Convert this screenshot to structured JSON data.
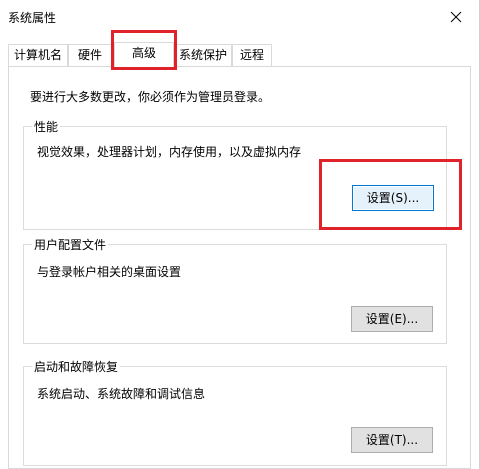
{
  "window": {
    "title": "系统属性"
  },
  "tabs": [
    {
      "label": "计算机名"
    },
    {
      "label": "硬件"
    },
    {
      "label": "高级"
    },
    {
      "label": "系统保护"
    },
    {
      "label": "远程"
    }
  ],
  "active_tab": "高级",
  "advanced": {
    "intro": "要进行大多数更改，你必须作为管理员登录。",
    "performance": {
      "title": "性能",
      "description": "视觉效果，处理器计划，内存使用，以及虚拟内存",
      "button": "设置(S)..."
    },
    "user_profiles": {
      "title": "用户配置文件",
      "description": "与登录帐户相关的桌面设置",
      "button": "设置(E)..."
    },
    "startup_recovery": {
      "title": "启动和故障恢复",
      "description": "系统启动、系统故障和调试信息",
      "button": "设置(T)..."
    }
  },
  "colors": {
    "annotation_red": "#e0232b",
    "focus_blue": "#0078d7",
    "button_face": "#e1e1e1"
  },
  "icons": {
    "close": "close-icon"
  }
}
